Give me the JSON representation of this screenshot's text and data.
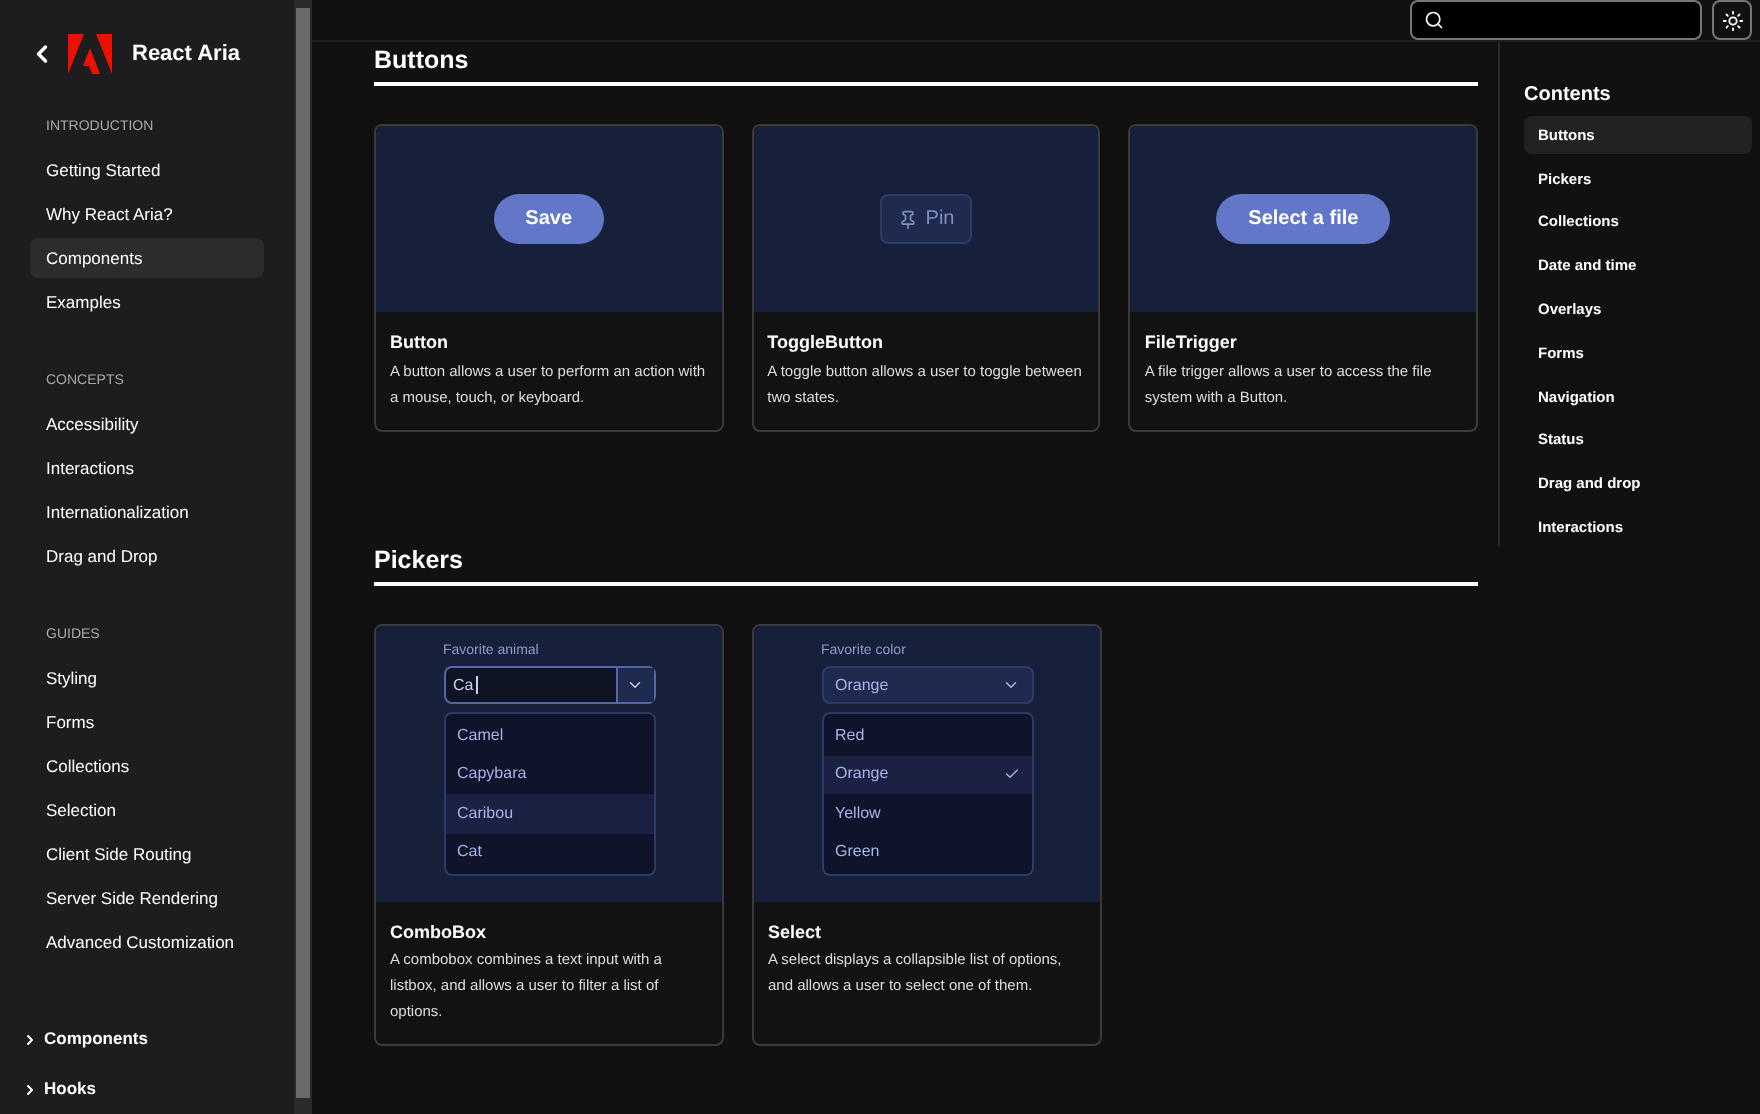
{
  "sidebar": {
    "title": "React Aria",
    "sections": [
      {
        "heading": "INTRODUCTION",
        "items": [
          {
            "label": "Getting Started",
            "selected": false
          },
          {
            "label": "Why React Aria?",
            "selected": false
          },
          {
            "label": "Components",
            "selected": true
          },
          {
            "label": "Examples",
            "selected": false
          }
        ]
      },
      {
        "heading": "CONCEPTS",
        "items": [
          {
            "label": "Accessibility",
            "selected": false
          },
          {
            "label": "Interactions",
            "selected": false
          },
          {
            "label": "Internationalization",
            "selected": false
          },
          {
            "label": "Drag and Drop",
            "selected": false
          }
        ]
      },
      {
        "heading": "GUIDES",
        "items": [
          {
            "label": "Styling",
            "selected": false
          },
          {
            "label": "Forms",
            "selected": false
          },
          {
            "label": "Collections",
            "selected": false
          },
          {
            "label": "Selection",
            "selected": false
          },
          {
            "label": "Client Side Routing",
            "selected": false
          },
          {
            "label": "Server Side Rendering",
            "selected": false
          },
          {
            "label": "Advanced Customization",
            "selected": false
          }
        ]
      }
    ],
    "groups": [
      {
        "label": "Components",
        "expanded": false
      },
      {
        "label": "Hooks",
        "expanded": false
      }
    ]
  },
  "sections": [
    {
      "heading": "Buttons",
      "cards": [
        {
          "title": "Button",
          "description": "A button allows a user to perform an action with a mouse, touch, or keyboard.",
          "preview": {
            "kind": "button",
            "label": "Save"
          }
        },
        {
          "title": "ToggleButton",
          "description": "A toggle button allows a user to toggle between two states.",
          "preview": {
            "kind": "toggle",
            "label": "Pin"
          }
        },
        {
          "title": "FileTrigger",
          "description": "A file trigger allows a user to access the file system with a Button.",
          "preview": {
            "kind": "button",
            "label": "Select a file"
          }
        }
      ]
    },
    {
      "heading": "Pickers",
      "cards": [
        {
          "title": "ComboBox",
          "description": "A combobox combines a text input with a listbox, and allows a user to filter a list of options.",
          "preview": {
            "kind": "combobox",
            "label": "Favorite animal",
            "value": "Ca",
            "options": [
              {
                "label": "Camel",
                "selected": false
              },
              {
                "label": "Capybara",
                "selected": false
              },
              {
                "label": "Caribou",
                "selected": true
              },
              {
                "label": "Cat",
                "selected": false
              }
            ]
          }
        },
        {
          "title": "Select",
          "description": "A select displays a collapsible list of options, and allows a user to select one of them.",
          "preview": {
            "kind": "select",
            "label": "Favorite color",
            "value": "Orange",
            "options": [
              {
                "label": "Red",
                "selected": false
              },
              {
                "label": "Orange",
                "selected": true
              },
              {
                "label": "Yellow",
                "selected": false
              },
              {
                "label": "Green",
                "selected": false
              }
            ]
          }
        }
      ]
    }
  ],
  "contents": {
    "title": "Contents",
    "items": [
      {
        "label": "Buttons",
        "selected": true
      },
      {
        "label": "Pickers",
        "selected": false
      },
      {
        "label": "Collections",
        "selected": false
      },
      {
        "label": "Date and time",
        "selected": false
      },
      {
        "label": "Overlays",
        "selected": false
      },
      {
        "label": "Forms",
        "selected": false
      },
      {
        "label": "Navigation",
        "selected": false
      },
      {
        "label": "Status",
        "selected": false
      },
      {
        "label": "Drag and drop",
        "selected": false
      },
      {
        "label": "Interactions",
        "selected": false
      }
    ]
  }
}
